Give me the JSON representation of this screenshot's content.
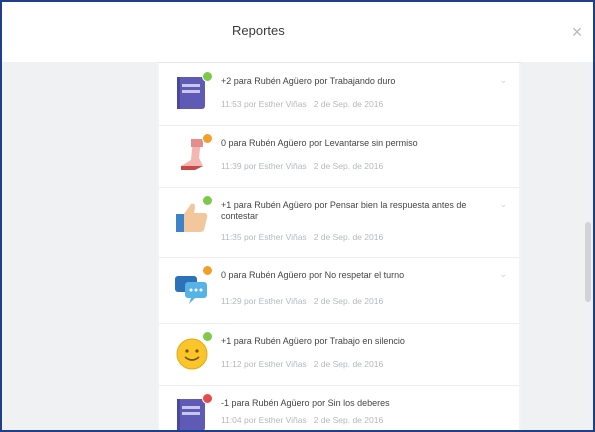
{
  "modal": {
    "title": "Reportes",
    "close_label": "×"
  },
  "items": [
    {
      "text": "+2 para Rubén Agüero por Trabajando duro",
      "time": "11:53 por Esther Viñas",
      "date": "2 de Sep. de 2016",
      "icon": "book-icon",
      "badge_color": "#7ec84a"
    },
    {
      "text": "0 para Rubén Agüero por Levantarse sin permiso",
      "time": "11:39 por Esther Viñas",
      "date": "2 de Sep. de 2016",
      "icon": "walking-leg-icon",
      "badge_color": "#f0a02a"
    },
    {
      "text": "+1 para Rubén Agüero por Pensar bien la respuesta antes de contestar",
      "time": "11:35 por Esther Viñas",
      "date": "2 de Sep. de 2016",
      "icon": "thumbs-up-icon",
      "badge_color": "#7ec84a"
    },
    {
      "text": "0 para Rubén Agüero por No respetar el turno",
      "time": "11:29 por Esther Viñas",
      "date": "2 de Sep. de 2016",
      "icon": "chat-bubbles-icon",
      "badge_color": "#f0a02a"
    },
    {
      "text": "+1 para Rubén Agüero por Trabajo en silencio",
      "time": "11:12 por Esther Viñas",
      "date": "2 de Sep. de 2016",
      "icon": "smiley-icon",
      "badge_color": "#7ec84a"
    },
    {
      "text": "-1 para Rubén Agüero por Sin los deberes",
      "time": "11:04 por Esther Viñas",
      "date": "2 de Sep. de 2016",
      "icon": "book-icon",
      "badge_color": "#e84a4a"
    }
  ]
}
